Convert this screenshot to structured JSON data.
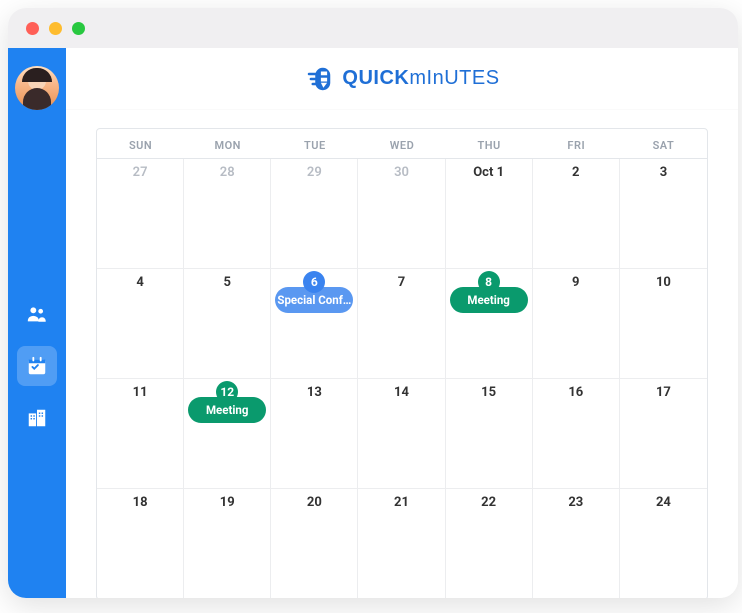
{
  "logo": {
    "text_strong": "QUICK",
    "text_thin": "mInUTES"
  },
  "sidebar": {
    "items": [
      {
        "name": "people-icon"
      },
      {
        "name": "calendar-icon"
      },
      {
        "name": "buildings-icon"
      }
    ],
    "activeIndex": 1
  },
  "calendar": {
    "headers": [
      "SUN",
      "MON",
      "TUE",
      "WED",
      "THU",
      "FRI",
      "SAT"
    ],
    "weeks": [
      [
        {
          "label": "27",
          "muted": true
        },
        {
          "label": "28",
          "muted": true
        },
        {
          "label": "29",
          "muted": true
        },
        {
          "label": "30",
          "muted": true
        },
        {
          "label": "Oct 1"
        },
        {
          "label": "2"
        },
        {
          "label": "3"
        }
      ],
      [
        {
          "label": "4"
        },
        {
          "label": "5"
        },
        {
          "label": "6",
          "bubble": "blue",
          "bubbleText": "6",
          "event": {
            "text": "Special Conf…",
            "color": "blue"
          }
        },
        {
          "label": "7"
        },
        {
          "label": "8",
          "bubble": "green",
          "bubbleText": "8",
          "event": {
            "text": "Meeting",
            "color": "green"
          }
        },
        {
          "label": "9"
        },
        {
          "label": "10"
        }
      ],
      [
        {
          "label": "11"
        },
        {
          "label": "12",
          "bubble": "green",
          "bubbleText": "12",
          "event": {
            "text": "Meeting",
            "color": "green"
          }
        },
        {
          "label": "13"
        },
        {
          "label": "14"
        },
        {
          "label": "15"
        },
        {
          "label": "16"
        },
        {
          "label": "17"
        }
      ],
      [
        {
          "label": "18"
        },
        {
          "label": "19"
        },
        {
          "label": "20"
        },
        {
          "label": "21"
        },
        {
          "label": "22"
        },
        {
          "label": "23"
        },
        {
          "label": "24"
        }
      ]
    ]
  }
}
